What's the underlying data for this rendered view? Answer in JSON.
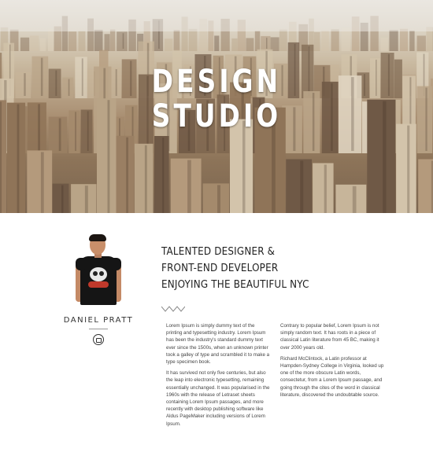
{
  "hero": {
    "title_line1": "DESIGN",
    "title_line2": "STUDIO"
  },
  "profile": {
    "name": "DANIEL PRATT",
    "social_icon": "camera-icon"
  },
  "headline": {
    "line1": "TALENTED DESIGNER &",
    "line2": "FRONT-END DEVELOPER",
    "line3": "ENJOYING THE BEAUTIFUL NYC"
  },
  "columns": {
    "left": [
      "Lorem Ipsum is simply dummy text of the printing and typesetting industry. Lorem Ipsum has been the industry's standard dummy text ever since the 1500s, when an unknown printer took a galley of type and scrambled it to make a type specimen book.",
      "It has survived not only five centuries, but also the leap into electronic typesetting, remaining essentially unchanged. It was popularised in the 1960s with the release of Letraset sheets containing Lorem Ipsum passages, and more recently with desktop publishing software like Aldus PageMaker including versions of Lorem Ipsum."
    ],
    "right": [
      "Contrary to popular belief, Lorem Ipsum is not simply random text. It has roots in a piece of classical Latin literature from 45 BC, making it over 2000 years old.",
      "Richard McClintock, a Latin professor at Hampden-Sydney College in Virginia, looked up one of the more obscure Latin words, consectetur, from a Lorem Ipsum passage, and going through the cites of the word in classical literature, discovered the undoubtable source."
    ]
  }
}
